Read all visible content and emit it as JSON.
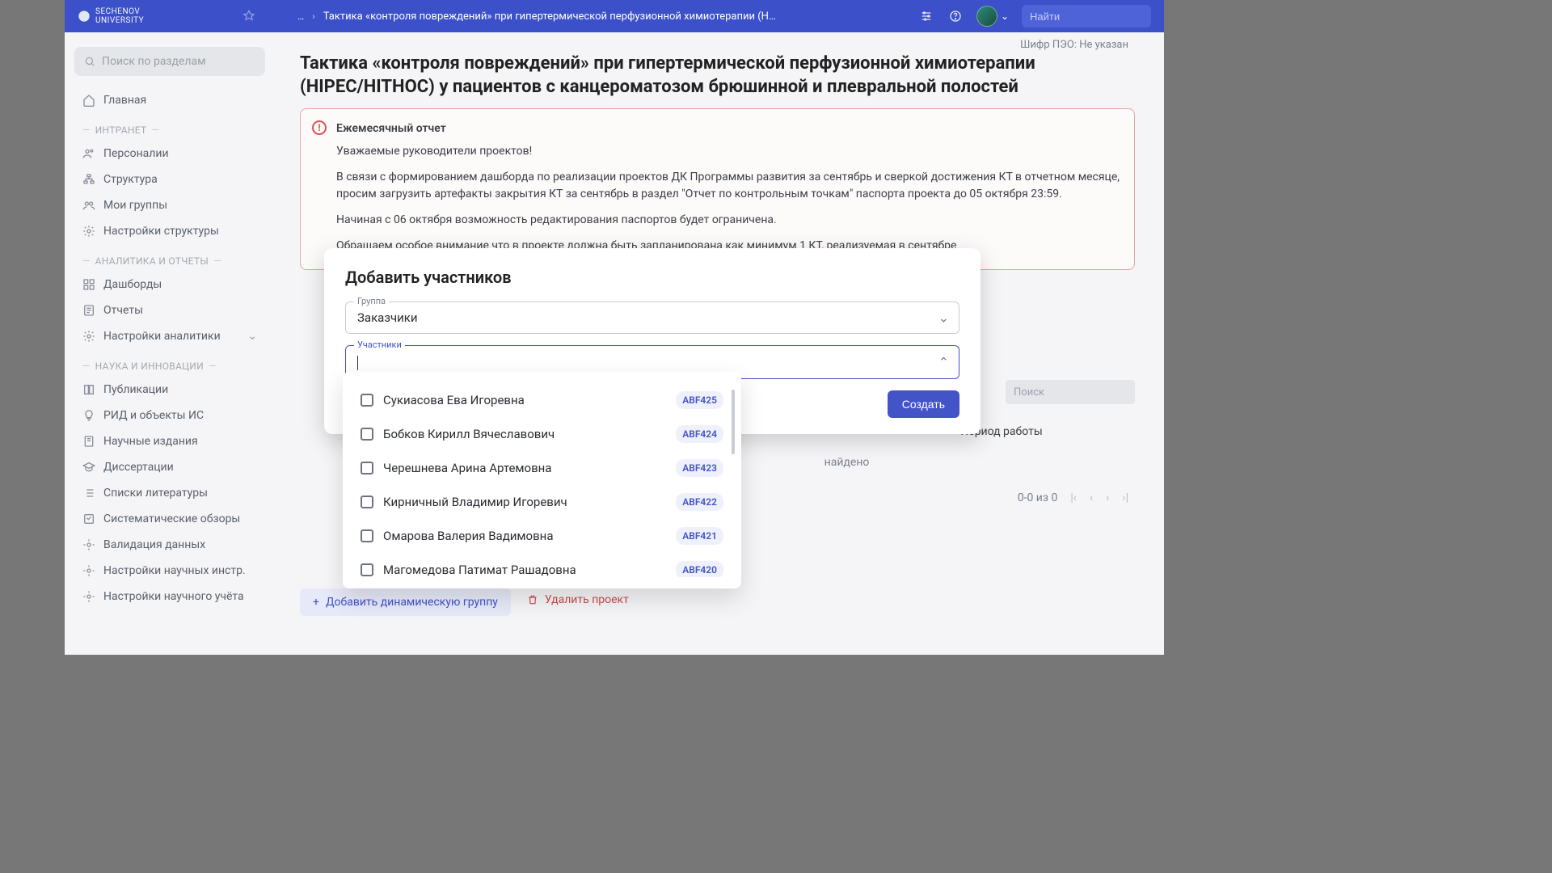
{
  "header": {
    "logo_line1": "SECHENOV",
    "logo_line2": "UNIVERSITY",
    "breadcrumb_ellipsis": "…",
    "breadcrumb_title": "Тактика «контроля повреждений» при гипертермической перфузионной химиотерапии (HIPEC/HITHOC) у...",
    "search_placeholder": "Найти"
  },
  "sidebar": {
    "search_placeholder": "Поиск по разделам",
    "home": "Главная",
    "sections": {
      "intranet": "ИНТРАНЕТ",
      "analytics": "АНАЛИТИКА И ОТЧЕТЫ",
      "science": "НАУКА И ИННОВАЦИИ"
    },
    "items": {
      "persons": "Персоналии",
      "structure": "Структура",
      "mygroups": "Мои группы",
      "struct_settings": "Настройки структуры",
      "dashboards": "Дашборды",
      "reports": "Отчеты",
      "analytics_settings": "Настройки аналитики",
      "publications": "Публикации",
      "rid": "РИД и объекты ИС",
      "journals": "Научные издания",
      "dissertations": "Диссертации",
      "lit_lists": "Списки литературы",
      "sys_reviews": "Систематические обзоры",
      "data_validation": "Валидация данных",
      "sci_instr_settings": "Настройки научных инстр.",
      "sci_acct_settings": "Настройки научного учёта"
    }
  },
  "page": {
    "cipher": "Шифр ПЭО: Не указан",
    "title": "Тактика «контроля повреждений» при гипертермической перфузионной химиотерапии (HIPEC/HITHOC) у пациентов с канцероматозом брюшинной и плевральной полостей",
    "alert": {
      "title": "Ежемесячный отчет",
      "p1": "Уважаемые руководители проектов!",
      "p2": "В связи с формированием дашборда по реализации проектов ДК Программы развития за сентябрь и сверкой достижения КТ в отчетном месяце, просим загрузить артефакты закрытия КТ за сентябрь в раздел \"Отчет по контрольным точкам\" паспорта проекта до 05 октября 23:59.",
      "p3": "Начиная с 06 октября возможность редактирования паспортов будет ограничена.",
      "p4": "Обращаем особое внимание что в проекте должна быть запланирована как минимум 1 КТ, реализуемая в сентябре"
    },
    "table": {
      "search_placeholder": "Поиск",
      "col_period": "Период работы",
      "empty_suffix": "найдено",
      "pager": "0-0 из 0"
    },
    "actions": {
      "add_dynamic": "Добавить динамическую группу",
      "delete_project": "Удалить проект"
    }
  },
  "modal": {
    "title": "Добавить участников",
    "group_label": "Группа",
    "group_value": "Заказчики",
    "participants_label": "Участники",
    "submit": "Создать",
    "options": [
      {
        "name": "Сукиасова Ева Игоревна",
        "code": "ABF425"
      },
      {
        "name": "Бобков Кирилл Вячеславович",
        "code": "ABF424"
      },
      {
        "name": "Черешнева Арина Артемовна",
        "code": "ABF423"
      },
      {
        "name": "Кирничный Владимир Игоревич",
        "code": "ABF422"
      },
      {
        "name": "Омарова Валерия Вадимовна",
        "code": "ABF421"
      },
      {
        "name": "Магомедова Патимат Рашадовна",
        "code": "ABF420"
      }
    ]
  }
}
